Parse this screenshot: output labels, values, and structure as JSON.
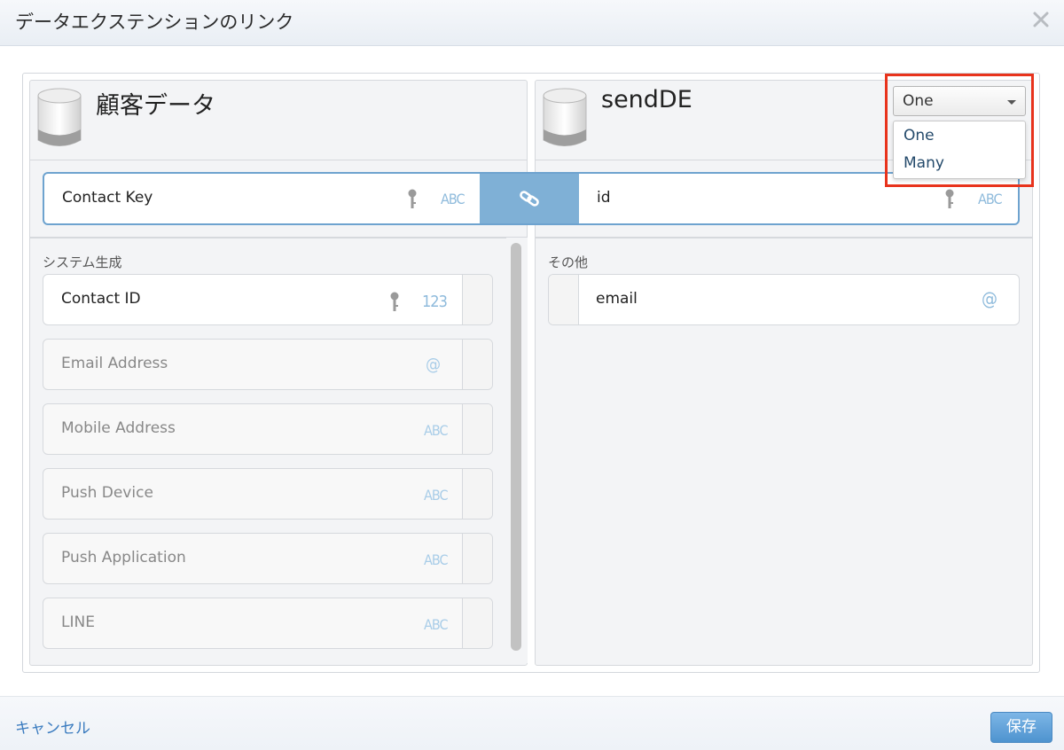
{
  "dialog": {
    "title": "データエクステンションのリンク"
  },
  "left": {
    "title": "顧客データ",
    "linked_field": {
      "name": "Contact Key",
      "type": "ABC"
    },
    "section": "システム生成",
    "fields": [
      {
        "name": "Contact ID",
        "type": "123",
        "key": true,
        "enabled": true
      },
      {
        "name": "Email Address",
        "type": "@",
        "key": false,
        "enabled": false
      },
      {
        "name": "Mobile Address",
        "type": "ABC",
        "key": false,
        "enabled": false
      },
      {
        "name": "Push Device",
        "type": "ABC",
        "key": false,
        "enabled": false
      },
      {
        "name": "Push Application",
        "type": "ABC",
        "key": false,
        "enabled": false
      },
      {
        "name": "LINE",
        "type": "ABC",
        "key": false,
        "enabled": false
      }
    ]
  },
  "right": {
    "title": "sendDE",
    "linked_field": {
      "name": "id",
      "type": "ABC"
    },
    "section": "その他",
    "fields": [
      {
        "name": "email",
        "type": "@"
      }
    ],
    "cardinality": {
      "selected": "One",
      "options": [
        "One",
        "Many"
      ]
    }
  },
  "footer": {
    "cancel": "キャンセル",
    "save": "保存"
  },
  "colors": {
    "accent": "#7fb0d6",
    "highlight": "#e8331c",
    "link_text": "#3a7bbf"
  }
}
